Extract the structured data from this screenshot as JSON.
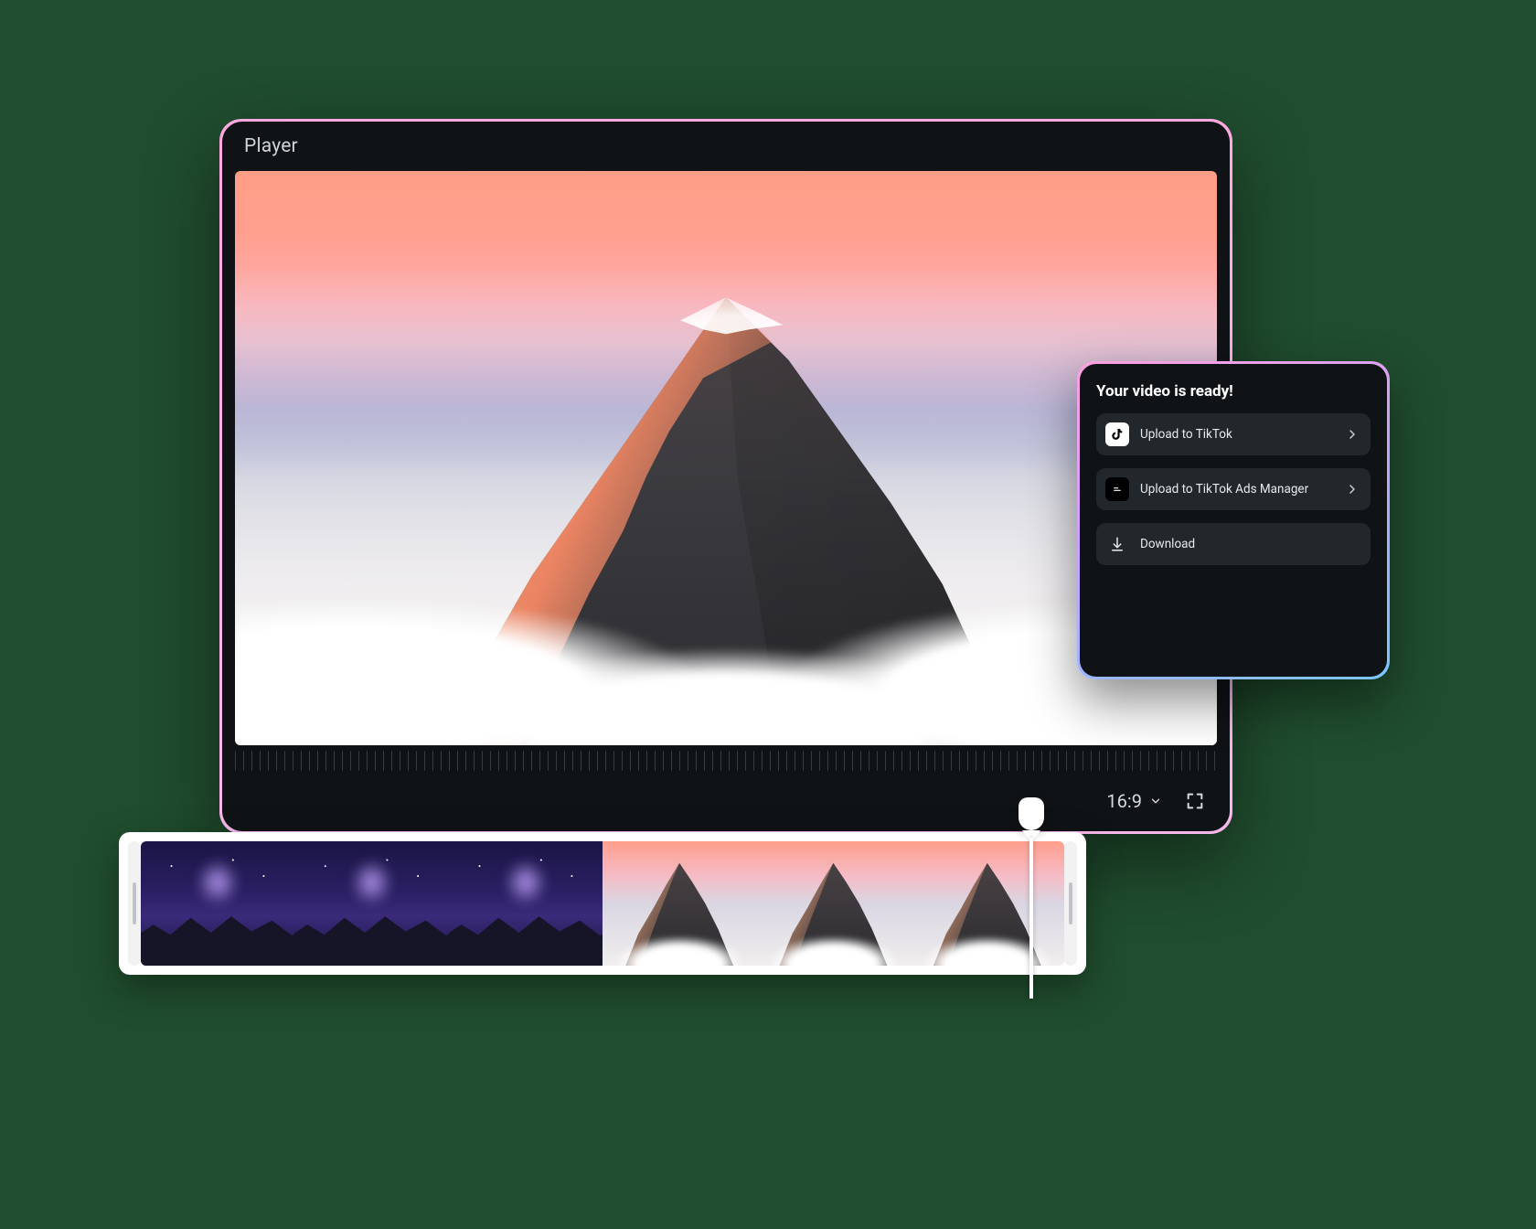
{
  "player": {
    "title": "Player",
    "aspect_ratio": "16:9"
  },
  "export_panel": {
    "title": "Your video is ready!",
    "options": [
      {
        "label": "Upload to TikTok",
        "has_chevron": true
      },
      {
        "label": "Upload to TikTok Ads Manager",
        "has_chevron": true
      },
      {
        "label": "Download",
        "has_chevron": false
      }
    ]
  },
  "timeline": {
    "clips": [
      {
        "kind": "night"
      },
      {
        "kind": "night"
      },
      {
        "kind": "night"
      },
      {
        "kind": "sunset"
      },
      {
        "kind": "sunset"
      },
      {
        "kind": "sunset"
      }
    ]
  }
}
